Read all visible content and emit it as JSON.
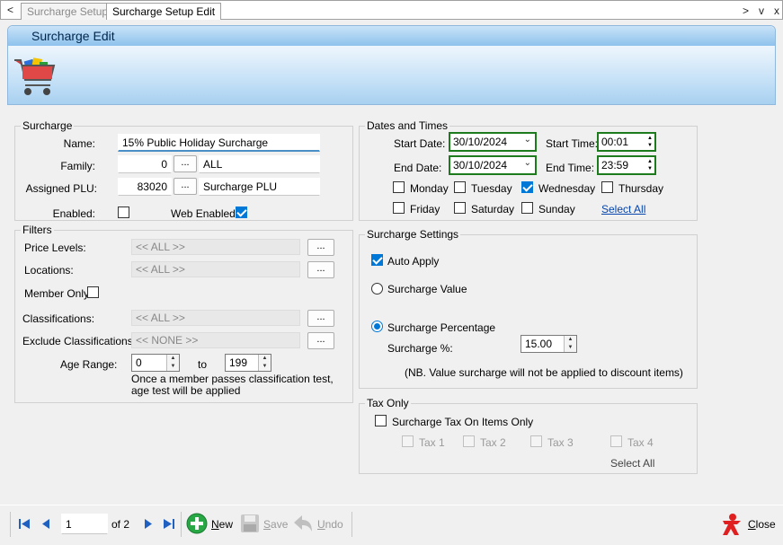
{
  "tabs": {
    "prev": "<",
    "items": [
      {
        "label": "Surcharge Setup"
      },
      {
        "label": "Surcharge Setup Edit"
      }
    ],
    "next": ">",
    "menu": "v",
    "close": "x"
  },
  "banner": {
    "title": "Surcharge Edit",
    "icon": "shopping-cart-icon"
  },
  "surcharge": {
    "group": "Surcharge",
    "name_label": "Name:",
    "name_value": "15% Public Holiday Surcharge",
    "family_label": "Family:",
    "family_code": "0",
    "family_name": "ALL",
    "plu_label": "Assigned PLU:",
    "plu_code": "83020",
    "plu_name": "Surcharge PLU",
    "enabled_label": "Enabled:",
    "web_enabled_label": "Web Enabled",
    "ellipsis": "..."
  },
  "filters": {
    "group": "Filters",
    "price_levels_label": "Price Levels:",
    "price_levels_value": "<< ALL >>",
    "locations_label": "Locations:",
    "locations_value": "<< ALL >>",
    "member_only_label": "Member Only",
    "classifications_label": "Classifications:",
    "classifications_value": "<< ALL >>",
    "exclude_label": "Exclude Classifications:",
    "exclude_value": "<< NONE >>",
    "age_label": "Age Range:",
    "age_from": "0",
    "age_to_label": "to",
    "age_to": "199",
    "note_line1": "Once a member passes classification test,",
    "note_line2": "age test will be applied",
    "ellipsis": "..."
  },
  "dates": {
    "group": "Dates and Times",
    "start_date_label": "Start Date:",
    "start_date": "30/10/2024",
    "end_date_label": "End Date:",
    "end_date": "30/10/2024",
    "start_time_label": "Start Time:",
    "start_time": "00:01",
    "end_time_label": "End Time:",
    "end_time": "23:59",
    "days": {
      "monday": "Monday",
      "tuesday": "Tuesday",
      "wednesday": "Wednesday",
      "thursday": "Thursday",
      "friday": "Friday",
      "saturday": "Saturday",
      "sunday": "Sunday"
    },
    "select_all": "Select All"
  },
  "settings": {
    "group": "Surcharge Settings",
    "auto_apply": "Auto Apply",
    "value_option": "Surcharge Value",
    "percentage_option": "Surcharge Percentage",
    "percent_label": "Surcharge %:",
    "percent_value": "15.00",
    "note": "(NB. Value surcharge will not be applied to discount items)"
  },
  "tax": {
    "group": "Tax Only",
    "items_only": "Surcharge Tax On Items Only",
    "tax1": "Tax 1",
    "tax2": "Tax 2",
    "tax3": "Tax 3",
    "tax4": "Tax 4",
    "select_all": "Select All"
  },
  "footer": {
    "page": "1",
    "of": "of 2",
    "new_rest": "ew",
    "new_key": "N",
    "save_rest": "ave",
    "save_key": "S",
    "undo_rest": "ndo",
    "undo_key": "U",
    "close_key": "C",
    "close_rest": "lose"
  },
  "colors": {
    "accent": "#0078d7",
    "highlight_border": "#1d7a1d",
    "link": "#0645ad"
  }
}
